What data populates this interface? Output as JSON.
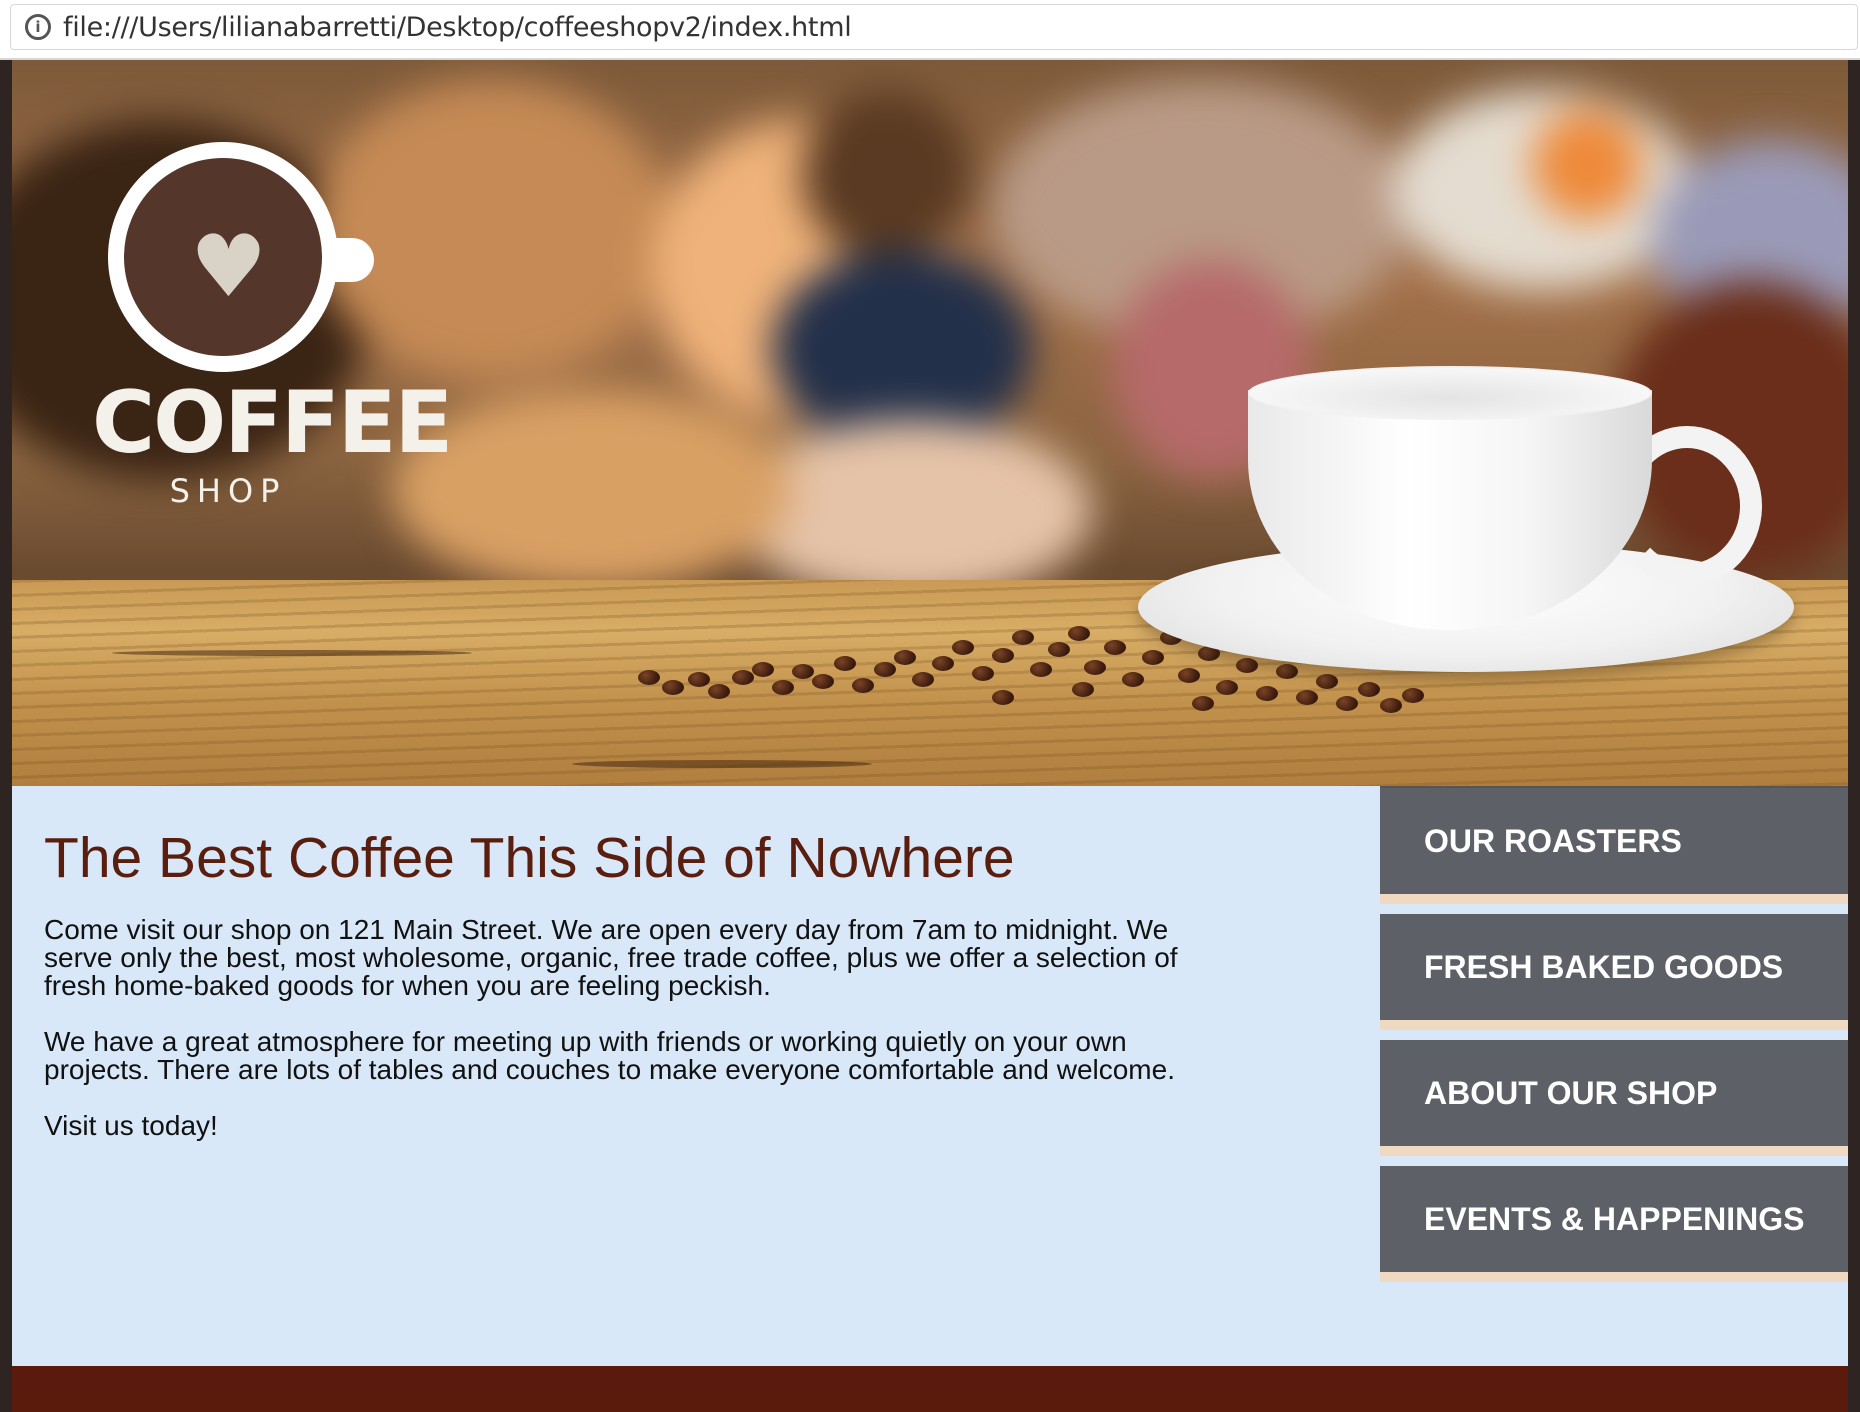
{
  "browser": {
    "url": "file:///Users/lilianabarretti/Desktop/coffeeshopv2/index.html",
    "info_icon": "info-icon"
  },
  "logo": {
    "title": "COFFEE",
    "subtitle": "SHOP",
    "icon": "coffee-cup-heart-icon"
  },
  "main": {
    "headline": "The Best Coffee This Side of Nowhere",
    "paragraphs": [
      "Come visit our shop on 121 Main Street. We are open every day from 7am to midnight. We serve only the best, most wholesome, organic, free trade coffee, plus we offer a selection of fresh home-baked goods for when you are feeling peckish.",
      "We have a great atmosphere for meeting up with friends or working quietly on your own projects. There are lots of tables and couches to make everyone comfortable and welcome.",
      "Visit us today!"
    ]
  },
  "nav": {
    "items": [
      {
        "label": "OUR ROASTERS"
      },
      {
        "label": "FRESH BAKED GOODS"
      },
      {
        "label": "ABOUT OUR SHOP"
      },
      {
        "label": "EVENTS & HAPPENINGS"
      }
    ]
  },
  "colors": {
    "headline": "#5a1e0e",
    "content_bg": "#d8e8f8",
    "nav_bg": "#5d6066",
    "nav_border": "#efd9c0",
    "footer": "#5a1a0c"
  }
}
